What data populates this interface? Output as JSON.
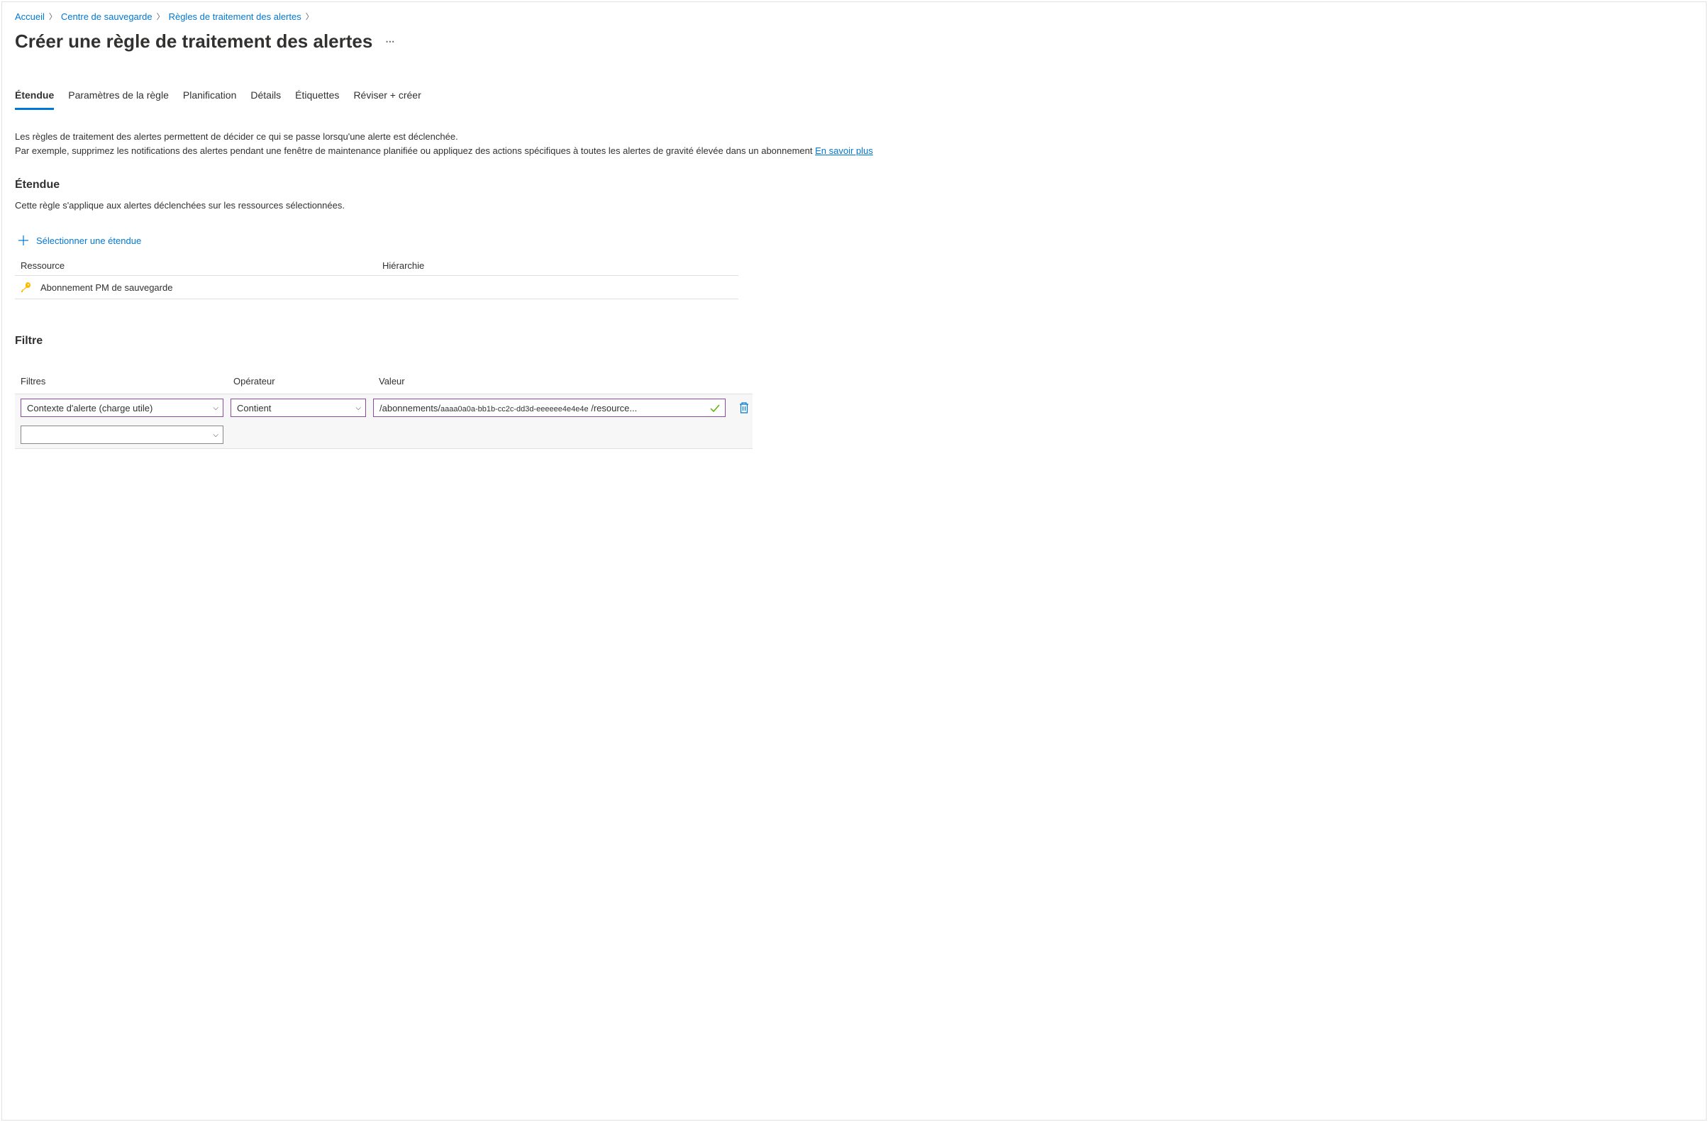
{
  "breadcrumb": {
    "items": [
      {
        "label": "Accueil"
      },
      {
        "label": "Centre de sauvegarde"
      },
      {
        "label": "Règles de traitement des alertes"
      }
    ]
  },
  "pageTitle": "Créer une règle de traitement des alertes",
  "tabs": [
    {
      "label": "Étendue",
      "active": true
    },
    {
      "label": "Paramètres de la règle"
    },
    {
      "label": "Planification"
    },
    {
      "label": "Détails"
    },
    {
      "label": "Étiquettes"
    },
    {
      "label": "Réviser + créer"
    }
  ],
  "description": {
    "line1": "Les règles de traitement des alertes permettent de décider ce qui se passe lorsqu'une alerte est déclenchée.",
    "line2a": "Par exemple, supprimez les notifications des alertes pendant une fenêtre de maintenance planifiée ou appliquez des actions spécifiques à toutes les alertes de gravité élevée dans un abonnement ",
    "learnMore": "En savoir plus"
  },
  "scope": {
    "heading": "Étendue",
    "text": "Cette règle s'applique aux alertes déclenchées sur les ressources sélectionnées.",
    "selectLink": "Sélectionner une étendue",
    "col1": "Ressource",
    "col2": "Hiérarchie",
    "resourceName": "Abonnement PM de sauvegarde"
  },
  "filter": {
    "heading": "Filtre",
    "col1": "Filtres",
    "col2": "Opérateur",
    "col3": "Valeur",
    "filterType": "Contexte d'alerte (charge utile)",
    "operator": "Contient",
    "valuePrefix": "/abonnements/",
    "valueGuid": "aaaa0a0a-bb1b-cc2c-dd3d-eeeeee4e4e4e",
    "valueSuffix": " /resource..."
  }
}
